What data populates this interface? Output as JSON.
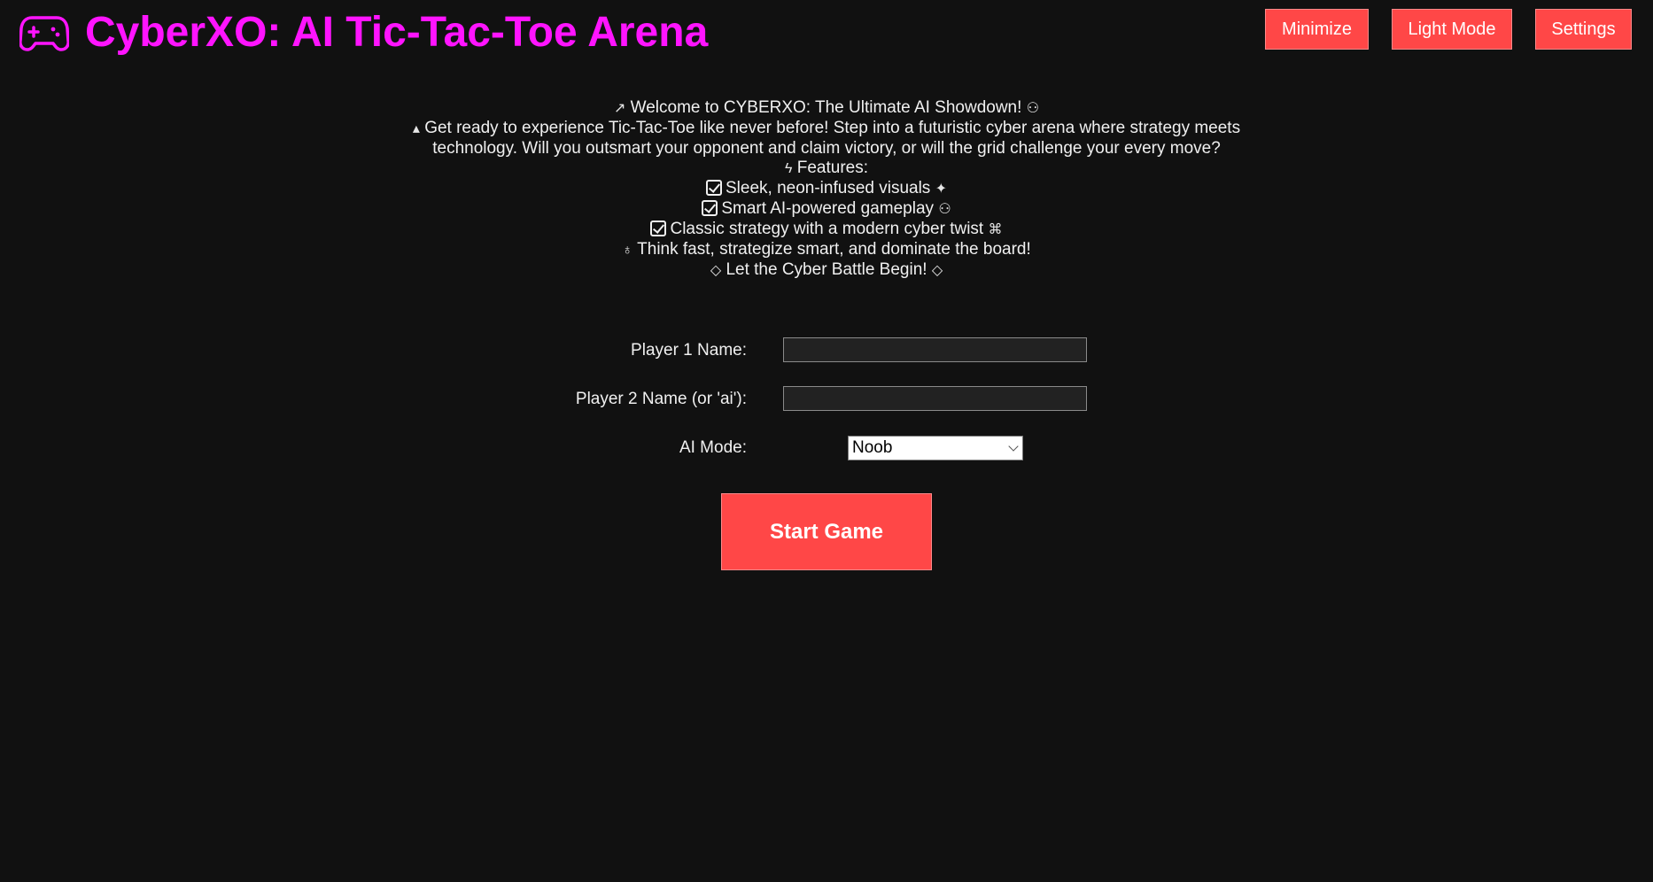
{
  "header": {
    "title": "CyberXO: AI Tic-Tac-Toe Arena",
    "logo_icon": "gamepad-icon",
    "title_color": "#ff14ff",
    "buttons": {
      "minimize": "Minimize",
      "light_mode": "Light Mode",
      "settings": "Settings"
    },
    "button_color": "#ff4747"
  },
  "intro": {
    "welcome": "Welcome to CYBERXO: The Ultimate AI Showdown!",
    "description": "Get ready to experience Tic-Tac-Toe like never before! Step into a futuristic cyber arena where strategy meets technology. Will you outsmart your opponent and claim victory, or will the grid challenge your every move?",
    "features_heading": "Features:",
    "features": [
      "Sleek, neon-infused visuals",
      "Smart AI-powered gameplay",
      "Classic strategy with a modern cyber twist"
    ],
    "tagline": "Think fast, strategize smart, and dominate the board!",
    "closing": "Let the Cyber Battle Begin!",
    "icons": {
      "welcome_lead": "rocket-icon",
      "welcome_trail": "robot-icon",
      "description_lead": "fire-icon",
      "features_lead": "lightning-icon",
      "feature_check": "checkbox-icon",
      "feature_trails": [
        "sparkles-icon",
        "robot-icon",
        "gamepad-icon"
      ],
      "tagline_lead": "lightbulb-icon",
      "closing_marks": "diamond-icon"
    }
  },
  "form": {
    "player1_label": "Player 1 Name:",
    "player1_value": "",
    "player2_label": "Player 2 Name (or 'ai'):",
    "player2_value": "",
    "ai_mode_label": "AI Mode:",
    "ai_mode_selected": "Noob",
    "start_button": "Start Game"
  }
}
